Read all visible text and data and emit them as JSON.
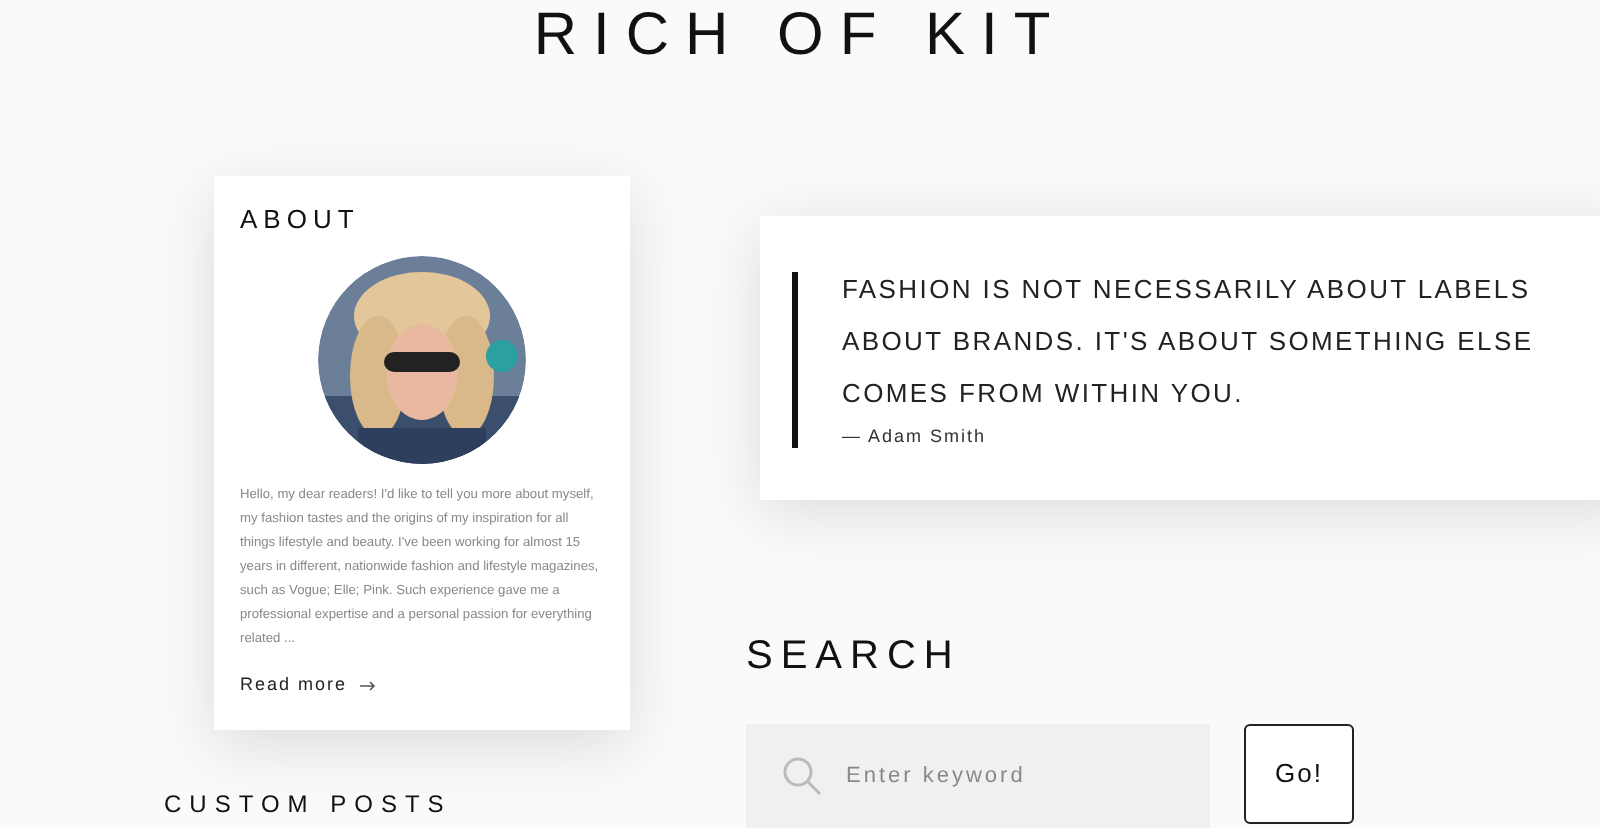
{
  "site_title": "RICH OF KIT",
  "about": {
    "heading": "ABOUT",
    "text": "Hello, my dear readers! I'd like to tell you more about myself, my fashion tastes and the origins of my inspiration for all things lifestyle and beauty. I've been working for almost 15 years in different, nationwide fashion and lifestyle magazines, such as Vogue; Elle; Pink. Such experience gave me a professional expertise and a personal passion for everything related ...",
    "link": "Read more"
  },
  "quote": {
    "lines": [
      "FASHION IS NOT NECESSARILY ABOUT LABELS",
      "ABOUT BRANDS. IT'S ABOUT SOMETHING ELSE",
      "COMES FROM WITHIN YOU."
    ],
    "author": "— Adam Smith"
  },
  "search": {
    "heading": "SEARCH",
    "placeholder": "Enter keyword",
    "button": "Go!"
  },
  "next_heading": "CUSTOM POSTS"
}
